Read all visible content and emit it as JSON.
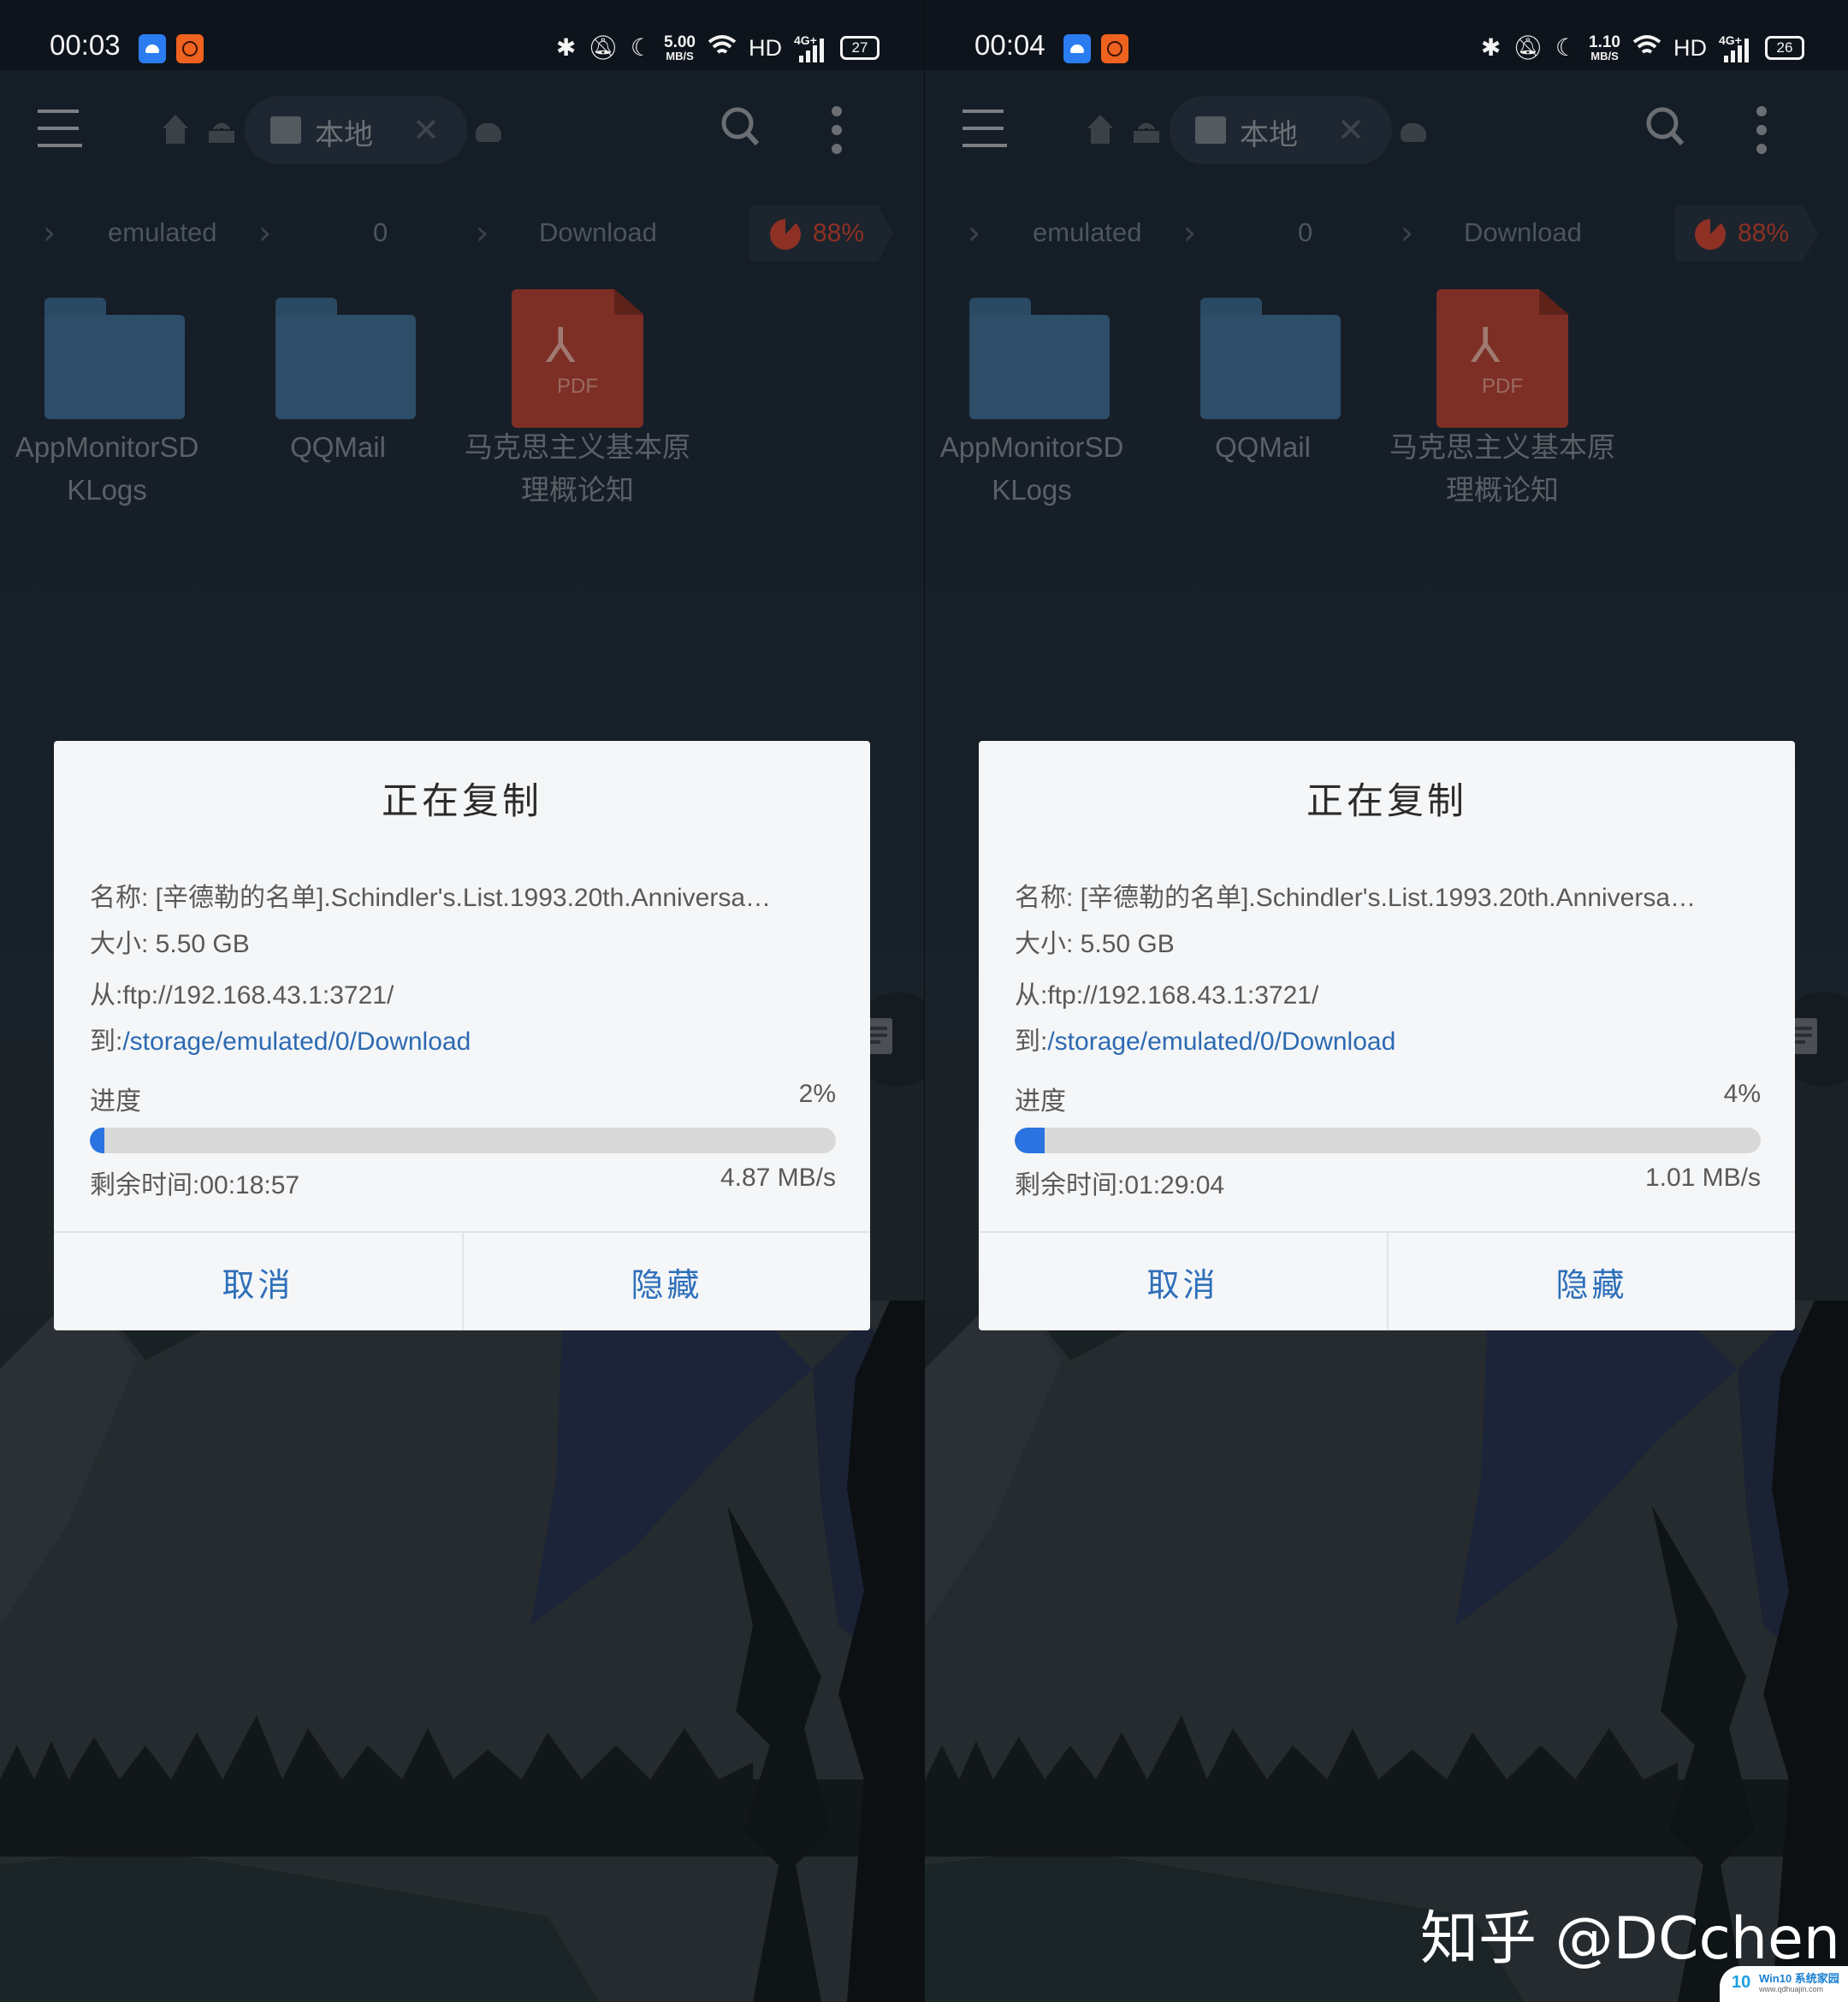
{
  "panels": [
    {
      "status_bar": {
        "time": "00:03",
        "net_speed_value": "5.00",
        "net_speed_unit": "MB/S",
        "hd": "HD",
        "network": "4G+",
        "battery": "27"
      },
      "toolbar": {
        "tab_label": "本地"
      },
      "breadcrumb": [
        "emulated",
        "0",
        "Download"
      ],
      "storage_usage": "88%",
      "files": [
        {
          "name": "AppMonitorSD KLogs",
          "type": "folder"
        },
        {
          "name": "QQMail",
          "type": "folder"
        },
        {
          "name": "马克思主义基本原理概论知",
          "type": "pdf"
        }
      ],
      "dialog": {
        "title": "正在复制",
        "name_label": "名称:",
        "name_value": " [辛德勒的名单].Schindler's.List.1993.20th.Anniversa…",
        "size_label": "大小:",
        "size_value": " 5.50 GB",
        "from_label": "从:",
        "from_value": "ftp://192.168.43.1:3721/",
        "to_label": "到:",
        "to_value": "/storage/emulated/0/Download",
        "progress_label": "进度",
        "progress_text": "2%",
        "progress_percent": 2,
        "remaining_label": "剩余时间:",
        "remaining_value": "00:18:57",
        "speed": "4.87 MB/s",
        "cancel_label": "取消",
        "hide_label": "隐藏"
      }
    },
    {
      "status_bar": {
        "time": "00:04",
        "net_speed_value": "1.10",
        "net_speed_unit": "MB/S",
        "hd": "HD",
        "network": "4G+",
        "battery": "26"
      },
      "toolbar": {
        "tab_label": "本地"
      },
      "breadcrumb": [
        "emulated",
        "0",
        "Download"
      ],
      "storage_usage": "88%",
      "files": [
        {
          "name": "AppMonitorSD KLogs",
          "type": "folder"
        },
        {
          "name": "QQMail",
          "type": "folder"
        },
        {
          "name": "马克思主义基本原理概论知",
          "type": "pdf"
        }
      ],
      "dialog": {
        "title": "正在复制",
        "name_label": "名称:",
        "name_value": " [辛德勒的名单].Schindler's.List.1993.20th.Anniversa…",
        "size_label": "大小:",
        "size_value": " 5.50 GB",
        "from_label": "从:",
        "from_value": "ftp://192.168.43.1:3721/",
        "to_label": "到:",
        "to_value": "/storage/emulated/0/Download",
        "progress_label": "进度",
        "progress_text": "4%",
        "progress_percent": 4,
        "remaining_label": "剩余时间:",
        "remaining_value": "01:29:04",
        "speed": "1.01 MB/s",
        "cancel_label": "取消",
        "hide_label": "隐藏"
      }
    }
  ],
  "pdf_badge_label": "PDF",
  "watermark": "知乎 @DCchen",
  "site_badge": {
    "logo": "10",
    "name": "Win10 系统家园",
    "url": "www.qdhuajin.com"
  },
  "colors": {
    "accent_blue": "#2a73e0",
    "link_blue": "#2d6ab1",
    "storage_red": "#8e3024",
    "folder_blue": "#2d4d68"
  }
}
